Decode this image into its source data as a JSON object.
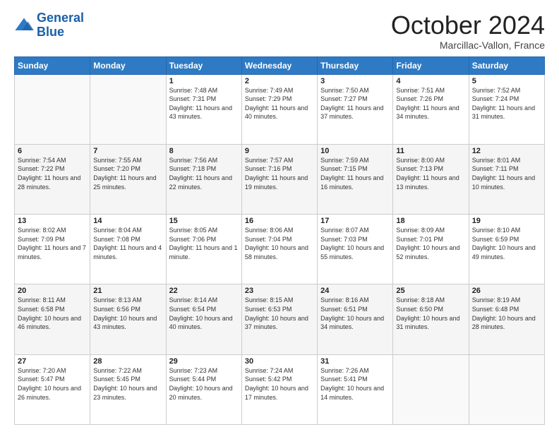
{
  "header": {
    "logo_line1": "General",
    "logo_line2": "Blue",
    "month_title": "October 2024",
    "location": "Marcillac-Vallon, France"
  },
  "days_of_week": [
    "Sunday",
    "Monday",
    "Tuesday",
    "Wednesday",
    "Thursday",
    "Friday",
    "Saturday"
  ],
  "weeks": [
    [
      {
        "num": "",
        "info": ""
      },
      {
        "num": "",
        "info": ""
      },
      {
        "num": "1",
        "info": "Sunrise: 7:48 AM\nSunset: 7:31 PM\nDaylight: 11 hours and 43 minutes."
      },
      {
        "num": "2",
        "info": "Sunrise: 7:49 AM\nSunset: 7:29 PM\nDaylight: 11 hours and 40 minutes."
      },
      {
        "num": "3",
        "info": "Sunrise: 7:50 AM\nSunset: 7:27 PM\nDaylight: 11 hours and 37 minutes."
      },
      {
        "num": "4",
        "info": "Sunrise: 7:51 AM\nSunset: 7:26 PM\nDaylight: 11 hours and 34 minutes."
      },
      {
        "num": "5",
        "info": "Sunrise: 7:52 AM\nSunset: 7:24 PM\nDaylight: 11 hours and 31 minutes."
      }
    ],
    [
      {
        "num": "6",
        "info": "Sunrise: 7:54 AM\nSunset: 7:22 PM\nDaylight: 11 hours and 28 minutes."
      },
      {
        "num": "7",
        "info": "Sunrise: 7:55 AM\nSunset: 7:20 PM\nDaylight: 11 hours and 25 minutes."
      },
      {
        "num": "8",
        "info": "Sunrise: 7:56 AM\nSunset: 7:18 PM\nDaylight: 11 hours and 22 minutes."
      },
      {
        "num": "9",
        "info": "Sunrise: 7:57 AM\nSunset: 7:16 PM\nDaylight: 11 hours and 19 minutes."
      },
      {
        "num": "10",
        "info": "Sunrise: 7:59 AM\nSunset: 7:15 PM\nDaylight: 11 hours and 16 minutes."
      },
      {
        "num": "11",
        "info": "Sunrise: 8:00 AM\nSunset: 7:13 PM\nDaylight: 11 hours and 13 minutes."
      },
      {
        "num": "12",
        "info": "Sunrise: 8:01 AM\nSunset: 7:11 PM\nDaylight: 11 hours and 10 minutes."
      }
    ],
    [
      {
        "num": "13",
        "info": "Sunrise: 8:02 AM\nSunset: 7:09 PM\nDaylight: 11 hours and 7 minutes."
      },
      {
        "num": "14",
        "info": "Sunrise: 8:04 AM\nSunset: 7:08 PM\nDaylight: 11 hours and 4 minutes."
      },
      {
        "num": "15",
        "info": "Sunrise: 8:05 AM\nSunset: 7:06 PM\nDaylight: 11 hours and 1 minute."
      },
      {
        "num": "16",
        "info": "Sunrise: 8:06 AM\nSunset: 7:04 PM\nDaylight: 10 hours and 58 minutes."
      },
      {
        "num": "17",
        "info": "Sunrise: 8:07 AM\nSunset: 7:03 PM\nDaylight: 10 hours and 55 minutes."
      },
      {
        "num": "18",
        "info": "Sunrise: 8:09 AM\nSunset: 7:01 PM\nDaylight: 10 hours and 52 minutes."
      },
      {
        "num": "19",
        "info": "Sunrise: 8:10 AM\nSunset: 6:59 PM\nDaylight: 10 hours and 49 minutes."
      }
    ],
    [
      {
        "num": "20",
        "info": "Sunrise: 8:11 AM\nSunset: 6:58 PM\nDaylight: 10 hours and 46 minutes."
      },
      {
        "num": "21",
        "info": "Sunrise: 8:13 AM\nSunset: 6:56 PM\nDaylight: 10 hours and 43 minutes."
      },
      {
        "num": "22",
        "info": "Sunrise: 8:14 AM\nSunset: 6:54 PM\nDaylight: 10 hours and 40 minutes."
      },
      {
        "num": "23",
        "info": "Sunrise: 8:15 AM\nSunset: 6:53 PM\nDaylight: 10 hours and 37 minutes."
      },
      {
        "num": "24",
        "info": "Sunrise: 8:16 AM\nSunset: 6:51 PM\nDaylight: 10 hours and 34 minutes."
      },
      {
        "num": "25",
        "info": "Sunrise: 8:18 AM\nSunset: 6:50 PM\nDaylight: 10 hours and 31 minutes."
      },
      {
        "num": "26",
        "info": "Sunrise: 8:19 AM\nSunset: 6:48 PM\nDaylight: 10 hours and 28 minutes."
      }
    ],
    [
      {
        "num": "27",
        "info": "Sunrise: 7:20 AM\nSunset: 5:47 PM\nDaylight: 10 hours and 26 minutes."
      },
      {
        "num": "28",
        "info": "Sunrise: 7:22 AM\nSunset: 5:45 PM\nDaylight: 10 hours and 23 minutes."
      },
      {
        "num": "29",
        "info": "Sunrise: 7:23 AM\nSunset: 5:44 PM\nDaylight: 10 hours and 20 minutes."
      },
      {
        "num": "30",
        "info": "Sunrise: 7:24 AM\nSunset: 5:42 PM\nDaylight: 10 hours and 17 minutes."
      },
      {
        "num": "31",
        "info": "Sunrise: 7:26 AM\nSunset: 5:41 PM\nDaylight: 10 hours and 14 minutes."
      },
      {
        "num": "",
        "info": ""
      },
      {
        "num": "",
        "info": ""
      }
    ]
  ]
}
